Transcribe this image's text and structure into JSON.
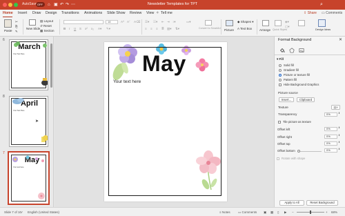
{
  "titlebar": {
    "autosave_label": "AutoSave",
    "autosave_state": "OFF",
    "doc_title": "Newsletter Templates for TPT",
    "icons": [
      "home-icon",
      "save-icon",
      "undo-icon",
      "redo-icon",
      "more-icon",
      "search-icon"
    ]
  },
  "tabs": {
    "items": [
      "Home",
      "Insert",
      "Draw",
      "Design",
      "Transitions",
      "Animations",
      "Slide Show",
      "Review",
      "View",
      "Tell me"
    ],
    "active": "Home",
    "share": "Share",
    "comments": "Comments"
  },
  "ribbon": {
    "paste": "Paste",
    "new_slide": "New Slide",
    "layout": "Layout",
    "reset": "Reset",
    "section": "Section",
    "picture": "Picture",
    "shapes": "Shapes",
    "text_box": "Text Box",
    "arrange": "Arrange",
    "quick_styles": "Quick Styles",
    "convert_smartart": "Convert to SmartArt",
    "design_ideas": "Design Ideas",
    "font_size": "18"
  },
  "slides": [
    {
      "number": "6",
      "title": "March",
      "body": "Your Text Here"
    },
    {
      "number": "8",
      "title": "April",
      "body": "Your Text Here"
    },
    {
      "number": "7",
      "title": "May",
      "body": "Your text here",
      "selected": true
    }
  ],
  "slide": {
    "title": "May",
    "body": "Your text here"
  },
  "format_pane": {
    "title": "Format Background",
    "section_fill": "Fill",
    "fill_options": [
      "Solid fill",
      "Gradient fill",
      "Picture or texture fill",
      "Pattern fill"
    ],
    "selected_fill": "Picture or texture fill",
    "hide_background_graphics": "Hide Background Graphics",
    "picture_source": "Picture source",
    "insert_btn": "Insert...",
    "clipboard_btn": "Clipboard",
    "texture_label": "Texture",
    "transparency_label": "Transparency",
    "transparency_value": "0%",
    "tile_label": "Tile picture as texture",
    "offsets": [
      {
        "label": "Offset left",
        "value": "0%"
      },
      {
        "label": "Offset right",
        "value": "0%"
      },
      {
        "label": "Offset top",
        "value": "0%"
      },
      {
        "label": "Offset bottom",
        "value": "0%"
      }
    ],
    "rotate_label": "Rotate with shape",
    "apply_all": "Apply to All",
    "reset_background": "Reset Background"
  },
  "status": {
    "slide_of": "Slide 7 of 10",
    "language": "English (United States)",
    "notes": "Notes",
    "comments": "Comments",
    "zoom": "68%"
  },
  "colors": {
    "titlebar": "#c7432b",
    "accent": "#b73b22",
    "selected_radio": "#1f66c9"
  }
}
